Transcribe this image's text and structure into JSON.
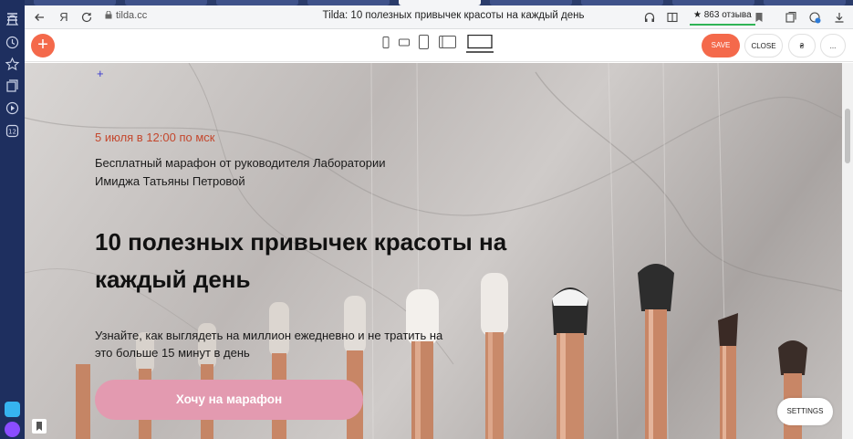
{
  "browser": {
    "url": "tilda.cc",
    "page_title": "Tilda: 10 полезных привычек красоты на каждый день",
    "reviews": "★ 863 отзыва",
    "nav_ya": "Я"
  },
  "toolbar": {
    "add_label": "+",
    "save_label": "SAVE",
    "close_label": "CLOSE",
    "symbol_label": "₴",
    "more_label": "...",
    "active_device": "desktop"
  },
  "hero": {
    "plus_marker": "+",
    "date": "5 июля в 12:00 по мск",
    "subtitle": "Бесплатный марафон от руководителя Лаборатории Имиджа Татьяны Петровой",
    "title": "10 полезных привычек красоты на каждый день",
    "description": "Узнайте, как выглядеть на миллион ежедневно и не тратить на это больше 15 минут в день",
    "cta_label": "Хочу на марафон",
    "settings_label": "SETTINGS"
  },
  "colors": {
    "accent": "#f4694b",
    "date_color": "#c4472d",
    "cta_color": "#e39ab0",
    "sidebar": "#1e2f5f"
  }
}
